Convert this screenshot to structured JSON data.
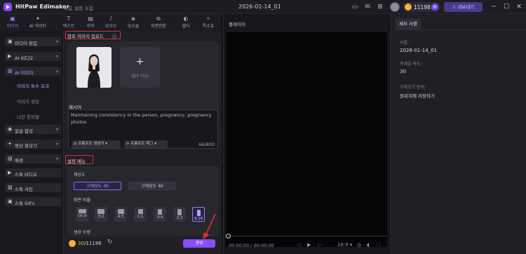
{
  "app": {
    "title": "HitPaw Edimakor",
    "menu": [
      "파일",
      "설정",
      "도움"
    ],
    "project_name": "2026-01-14_01",
    "credits": "11198",
    "export_label": "내보내기"
  },
  "tools": [
    {
      "icon": "media-icon",
      "glyph": "▣",
      "label": "미디어",
      "active": true
    },
    {
      "icon": "ai-icon",
      "glyph": "✦",
      "label": "AI 아바타",
      "active": false
    },
    {
      "icon": "text-icon",
      "glyph": "T",
      "label": "텍스트",
      "active": false
    },
    {
      "icon": "caption-icon",
      "glyph": "▤",
      "label": "자막",
      "active": false
    },
    {
      "icon": "audio-icon",
      "glyph": "♪",
      "label": "오디오",
      "active": false
    },
    {
      "icon": "element-icon",
      "glyph": "◈",
      "label": "요소들",
      "active": false
    },
    {
      "icon": "transition-icon",
      "glyph": "⧉",
      "label": "화면전환",
      "active": false
    },
    {
      "icon": "filter-icon",
      "glyph": "◐",
      "label": "필터",
      "active": false
    },
    {
      "icon": "effect-icon",
      "glyph": "✧",
      "label": "특수효",
      "active": false
    }
  ],
  "sidebar": {
    "items": [
      {
        "label": "미디어 편집",
        "glyph": "▣",
        "chev": "▾",
        "active": false
      },
      {
        "label": "AI 비디오",
        "glyph": "▶",
        "chev": "▾",
        "active": false
      },
      {
        "label": "AI 이미지",
        "glyph": "▨",
        "chev": "▴",
        "active": true
      },
      {
        "label": "얼굴 합성",
        "glyph": "◉",
        "chev": "▾",
        "active": false
      },
      {
        "label": "영상 향상기",
        "glyph": "✦",
        "chev": "▾",
        "active": false
      },
      {
        "label": "배경",
        "glyph": "▧",
        "chev": "▾",
        "active": false
      },
      {
        "label": "스톡 비디오",
        "glyph": "▶",
        "chev": "",
        "active": false
      },
      {
        "label": "스톡 사진",
        "glyph": "▨",
        "chev": "",
        "active": false
      },
      {
        "label": "스톡 GIFs",
        "glyph": "▣",
        "chev": "",
        "active": false
      }
    ],
    "sub_items": [
      {
        "label": "이미지 특수 효과",
        "active": true
      },
      {
        "label": "이미지 생성",
        "active": false
      },
      {
        "label": "나만 창작물",
        "active": false
      }
    ]
  },
  "panel": {
    "upload_title": "참조 이미지 업로드",
    "info_icon": "ⓘ",
    "add_label": "(필수 아님)",
    "desc_label": "제시어",
    "desc_text": "Maintaining consistency in the person, pregnancy, pregnancy photos",
    "prompt_gen_label": "프롬프트 생성기",
    "prompt_tag_label": "프롬프트 태그",
    "counter": "66/800",
    "settings_title": "설정 메뉴",
    "resolution_label": "해상도",
    "resolutions": [
      {
        "label": "고해상도 2K",
        "active": true
      },
      {
        "label": "고해상도 4K",
        "active": false
      }
    ],
    "ratio_label": "화면 비율",
    "ratios": [
      {
        "label": "16:9",
        "active": false
      },
      {
        "label": "3:2",
        "active": false
      },
      {
        "label": "4:3",
        "active": false
      },
      {
        "label": "1:1",
        "active": false
      },
      {
        "label": "3:4",
        "active": false
      },
      {
        "label": "2:3",
        "active": false
      },
      {
        "label": "9:16",
        "active": true
      }
    ],
    "count_label": "생성 수량",
    "cost_used": "30",
    "cost_total": "/11198",
    "generate_label": "생성"
  },
  "player": {
    "title": "플레이어",
    "time": "00:00:00 / 00:00:00",
    "ratio": "16:9"
  },
  "details": {
    "tab": "세부 사항",
    "name_label": "이름:",
    "name_value": "2026-01-14_01",
    "fps_label": "프레임 속도:",
    "fps_value": "30",
    "import_label": "가져오기 방식:",
    "import_value": "원위치에 저장하기"
  },
  "colors": {
    "accent": "#8a4cff",
    "highlight": "#e0302e",
    "coin": "#f2b33d"
  }
}
